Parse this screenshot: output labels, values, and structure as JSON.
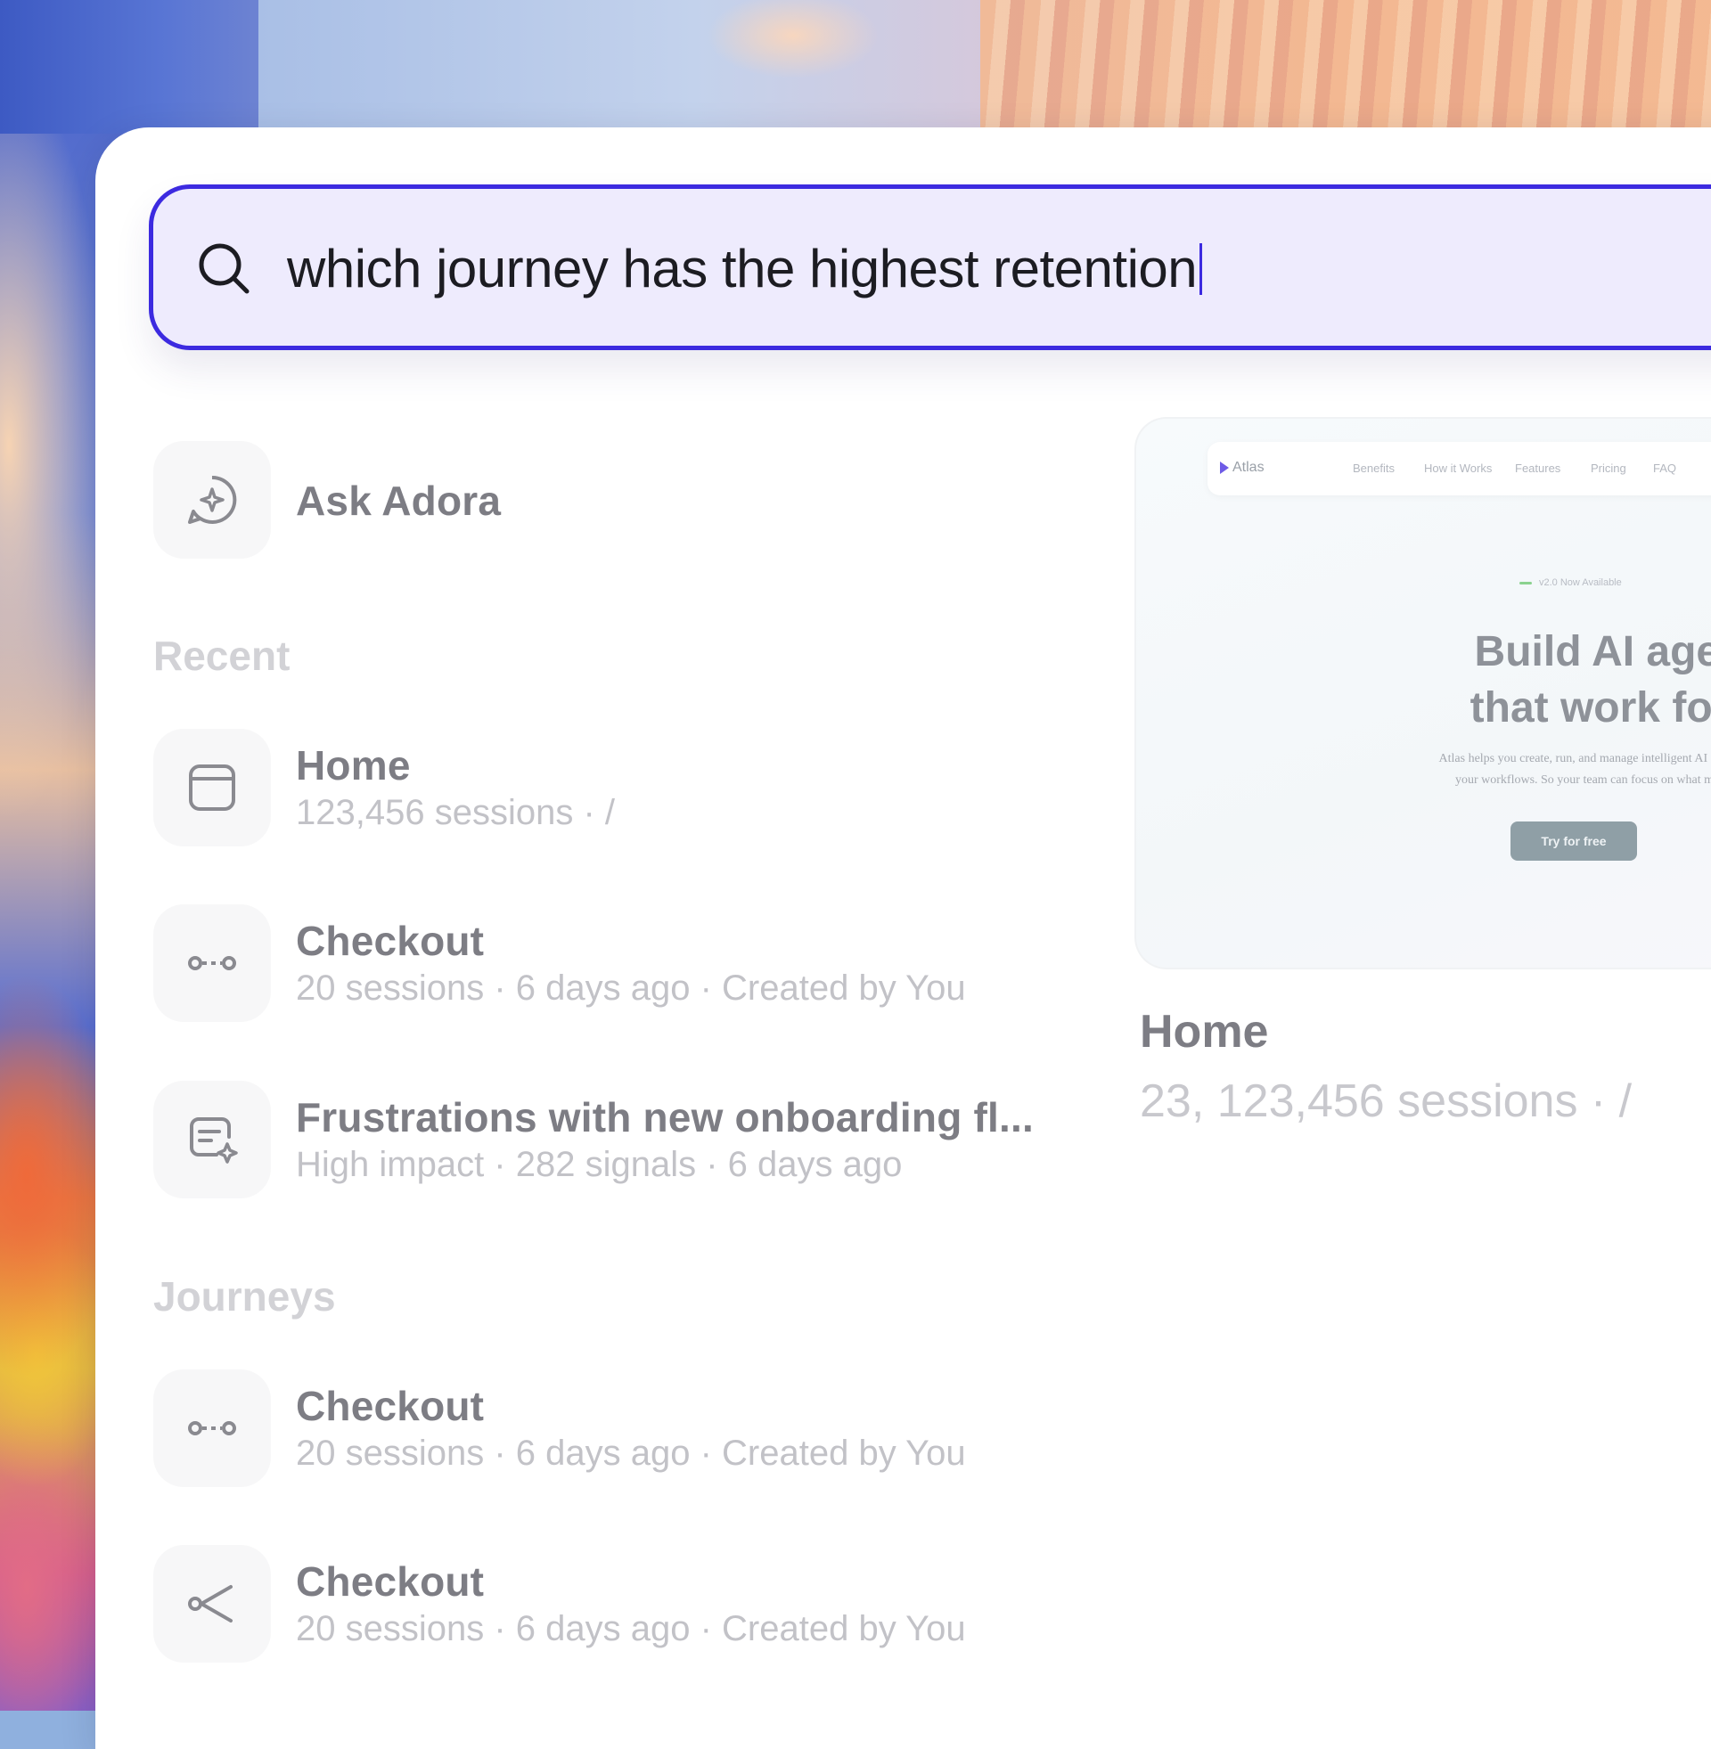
{
  "search": {
    "query": "which journey has the highest retention"
  },
  "ask": {
    "label": "Ask Adora",
    "icon": "sparkle-chat-icon"
  },
  "recent": {
    "label": "Recent",
    "items": [
      {
        "title": "Home",
        "meta": "123,456 sessions · /",
        "icon": "page-icon"
      },
      {
        "title": "Checkout",
        "meta": "20 sessions · 6 days ago · Created by You",
        "icon": "journey-icon"
      },
      {
        "title": "Frustrations with new onboarding fl...",
        "meta": "High impact · 282 signals · 6 days ago",
        "icon": "insight-icon"
      }
    ]
  },
  "journeys": {
    "label": "Journeys",
    "items": [
      {
        "title": "Checkout",
        "meta": "20 sessions · 6 days ago · Created by You",
        "icon": "journey-icon"
      },
      {
        "title": "Checkout",
        "meta": "20 sessions · 6 days ago · Created by You",
        "icon": "branch-journey-icon"
      }
    ]
  },
  "preview": {
    "site": {
      "logo": "Atlas",
      "nav": [
        "Benefits",
        "How it Works",
        "Features",
        "Pricing",
        "FAQ"
      ],
      "badge": "v2.0 Now Available",
      "headline_1": "Build AI agent",
      "headline_2": "that work for y",
      "paragraph_1": "Atlas helps you create, run, and manage intelligent AI agents",
      "paragraph_2": "your workflows. So your team can focus on what matt",
      "cta": "Try for free"
    },
    "title": "Home",
    "meta": "23, 123,456 sessions · /"
  },
  "colors": {
    "accent": "#3c2ae0",
    "search_bg": "#eeebfd",
    "title": "#7d7d84",
    "meta": "#c2c2c7"
  }
}
